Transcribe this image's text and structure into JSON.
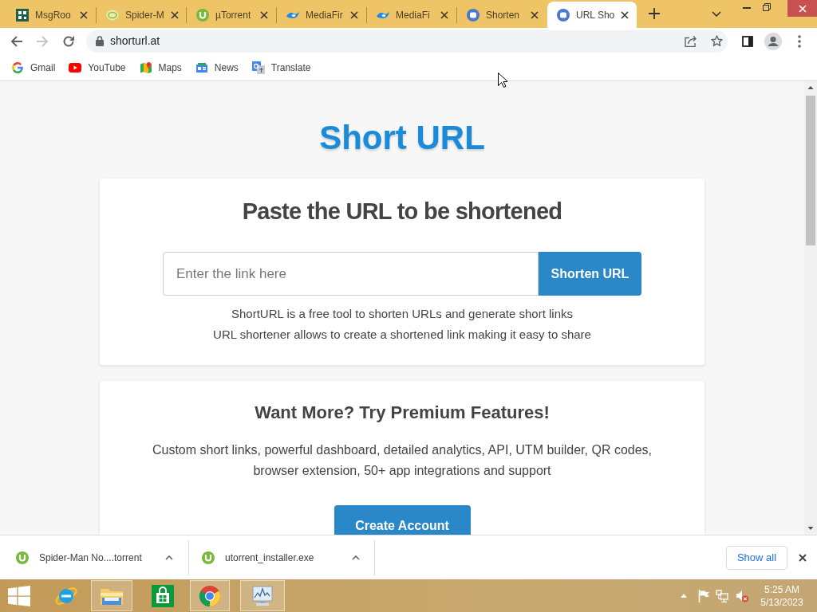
{
  "tabs": [
    {
      "title": "MsgRoo",
      "selected": false
    },
    {
      "title": "Spider-M",
      "selected": false
    },
    {
      "title": "µTorrent",
      "selected": false
    },
    {
      "title": "MediaFir",
      "selected": false
    },
    {
      "title": "MediaFi",
      "selected": false
    },
    {
      "title": "Shorten",
      "selected": false
    },
    {
      "title": "URL Sho",
      "selected": true
    }
  ],
  "toolbar": {
    "back": {
      "disabled": false
    },
    "forward": {
      "disabled": true
    },
    "url": "shorturl.at"
  },
  "bookmarks": [
    "Gmail",
    "YouTube",
    "Maps",
    "News",
    "Translate"
  ],
  "page": {
    "title": "Short URL",
    "shorten_card": {
      "heading": "Paste the URL to be shortened",
      "input": {
        "placeholder": "Enter the link here"
      },
      "button": "Shorten URL",
      "description": [
        "ShortURL is a free tool to shorten URLs and generate short links",
        "URL shortener allows to create a shortened link making it easy to share"
      ]
    },
    "premium_card": {
      "heading": "Want More? Try Premium Features!",
      "text": "Custom short links, powerful dashboard, detailed analytics, API, UTM builder, QR codes, browser extension, 50+ app integrations and support",
      "button": "Create Account"
    }
  },
  "downloads": {
    "items": [
      {
        "filename": "Spider-Man No....torrent"
      },
      {
        "filename": "utorrent_installer.exe"
      }
    ],
    "show_all": "Show all"
  },
  "taskbar": {
    "apps": [
      {
        "running": false
      },
      {
        "running": true
      },
      {
        "running": false
      },
      {
        "running": true
      },
      {
        "running": true
      }
    ],
    "clock": {
      "time": "5:25 AM",
      "date": "5/13/2023"
    }
  }
}
